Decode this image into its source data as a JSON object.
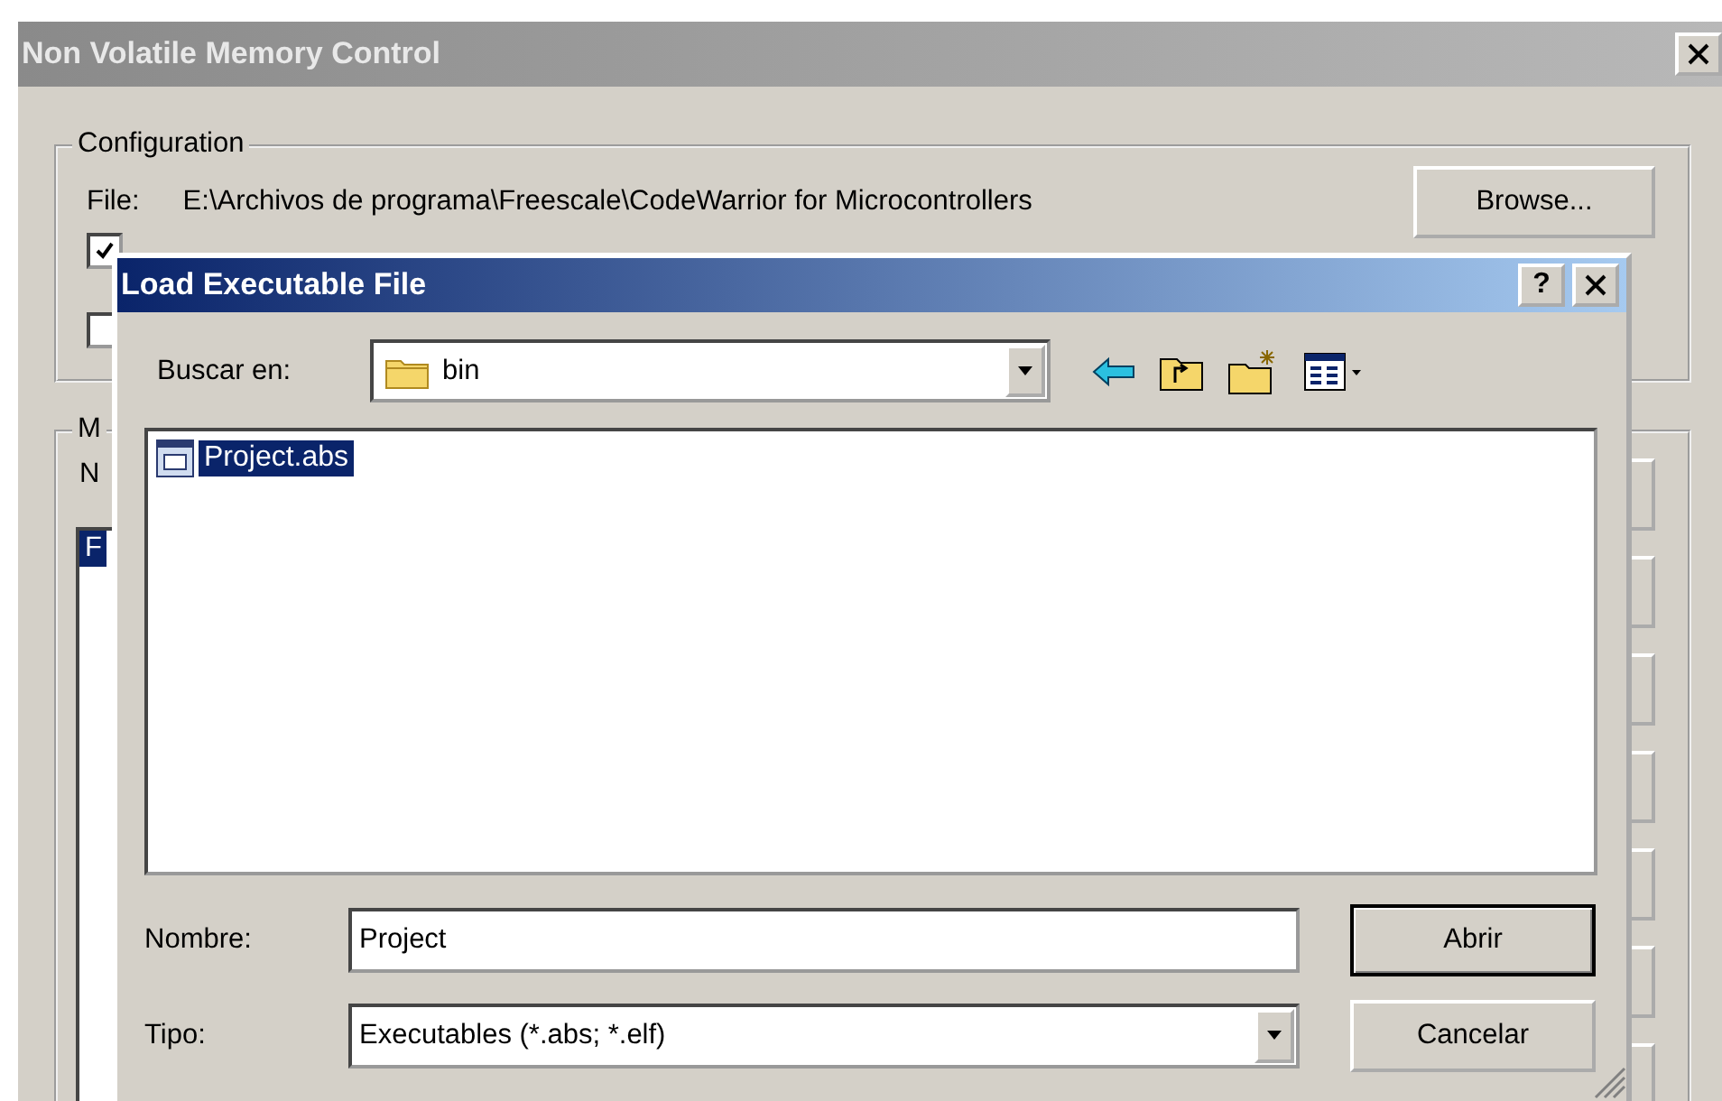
{
  "main_window": {
    "title": "Non Volatile Memory Control",
    "configuration": {
      "legend": "Configuration",
      "file_label": "File:",
      "file_path": "E:\\Archivos de programa\\Freescale\\CodeWarrior for Microcontrollers",
      "browse_button": "Browse...",
      "checkboxes": [
        {
          "checked": true
        },
        {
          "checked": false
        }
      ]
    },
    "group_2": {
      "legend": "M",
      "label": "N",
      "list_items": [
        {
          "label": "F",
          "selected": true
        }
      ]
    }
  },
  "dialog": {
    "title": "Load Executable File",
    "help_button": "?",
    "look_in_label": "Buscar en:",
    "look_in_value": "bin",
    "files": [
      {
        "name": "Project.abs",
        "selected": true
      }
    ],
    "name_label": "Nombre:",
    "name_value": "Project",
    "type_label": "Tipo:",
    "type_value": "Executables (*.abs; *.elf)",
    "open_button": "Abrir",
    "cancel_button": "Cancelar"
  }
}
